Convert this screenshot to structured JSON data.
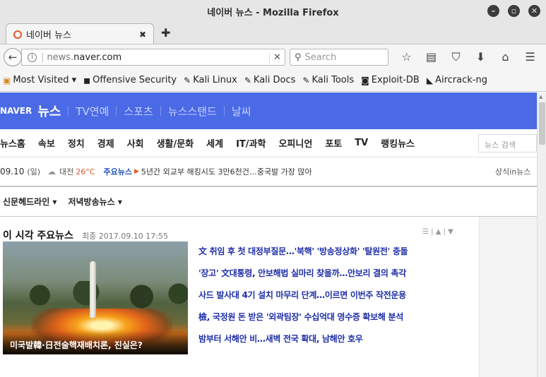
{
  "window": {
    "title": "네이버 뉴스 - Mozilla Firefox"
  },
  "tab": {
    "label": "네이버 뉴스",
    "close_label": "✖",
    "new_tab_label": "✚"
  },
  "navbar": {
    "back_label": "←",
    "url_host_prefix": "news.",
    "url_domain": "naver.com",
    "clear_label": "✕",
    "search_placeholder": "Search",
    "icons": [
      "star-icon",
      "reader-icon",
      "pocket-icon",
      "download-icon",
      "home-icon",
      "menu-icon"
    ]
  },
  "bookmarks": [
    {
      "label": "Most Visited ▾",
      "icon": "folder-icon"
    },
    {
      "label": "Offensive Security",
      "icon": "offsec-icon"
    },
    {
      "label": "Kali Linux",
      "icon": "kali-icon"
    },
    {
      "label": "Kali Docs",
      "icon": "kali-icon"
    },
    {
      "label": "Kali Tools",
      "icon": "kali-icon"
    },
    {
      "label": "Exploit-DB",
      "icon": "exploitdb-icon"
    },
    {
      "label": "Aircrack-ng",
      "icon": "aircrack-icon"
    }
  ],
  "header": {
    "logo": "NAVER",
    "section": "뉴스",
    "links": [
      "TV연예",
      "스포츠",
      "뉴스스탠드",
      "날씨"
    ]
  },
  "gnb": {
    "items": [
      "뉴스홈",
      "속보",
      "정치",
      "경제",
      "사회",
      "생활/문화",
      "세계",
      "IT/과학",
      "오피니언",
      "포토",
      "TV",
      "랭킹뉴스"
    ],
    "search_placeholder": "뉴스 검색"
  },
  "ticker": {
    "date": "09.10",
    "weekday": "(일)",
    "city": "대전",
    "temp": "26°C",
    "main_label": "주요뉴스",
    "headline": "5년간 외교부 해킹시도 3만6천건…중국발 가장 많아",
    "right_link": "상식in뉴스"
  },
  "subbar": {
    "items": [
      "신문헤드라인 ▾",
      "저녁방송뉴스 ▾"
    ]
  },
  "main": {
    "title": "이 시각 주요뉴스",
    "timestamp": "최종 2017.09.10 17:55",
    "controls": "☰ | ▲ | ▼",
    "photo_caption": "미국발韓·日전술핵재배치론, 진실은?",
    "headlines": [
      "文 취임 후 첫 대정부질문…'북핵' '방송정상화' '탈원전' 충돌",
      "'장고' 文대통령, 안보해법 실마리 찾을까…안보리 결의 촉각",
      "사드 발사대 4기 설치 마무리 단계…이르면 이번주 작전운용",
      "檢, 국정원 돈 받은 '외곽팀장' 수십억대 영수증 확보해 분석",
      "밤부터 서해안 비…새벽 전국 확대, 남해안 호우"
    ]
  }
}
